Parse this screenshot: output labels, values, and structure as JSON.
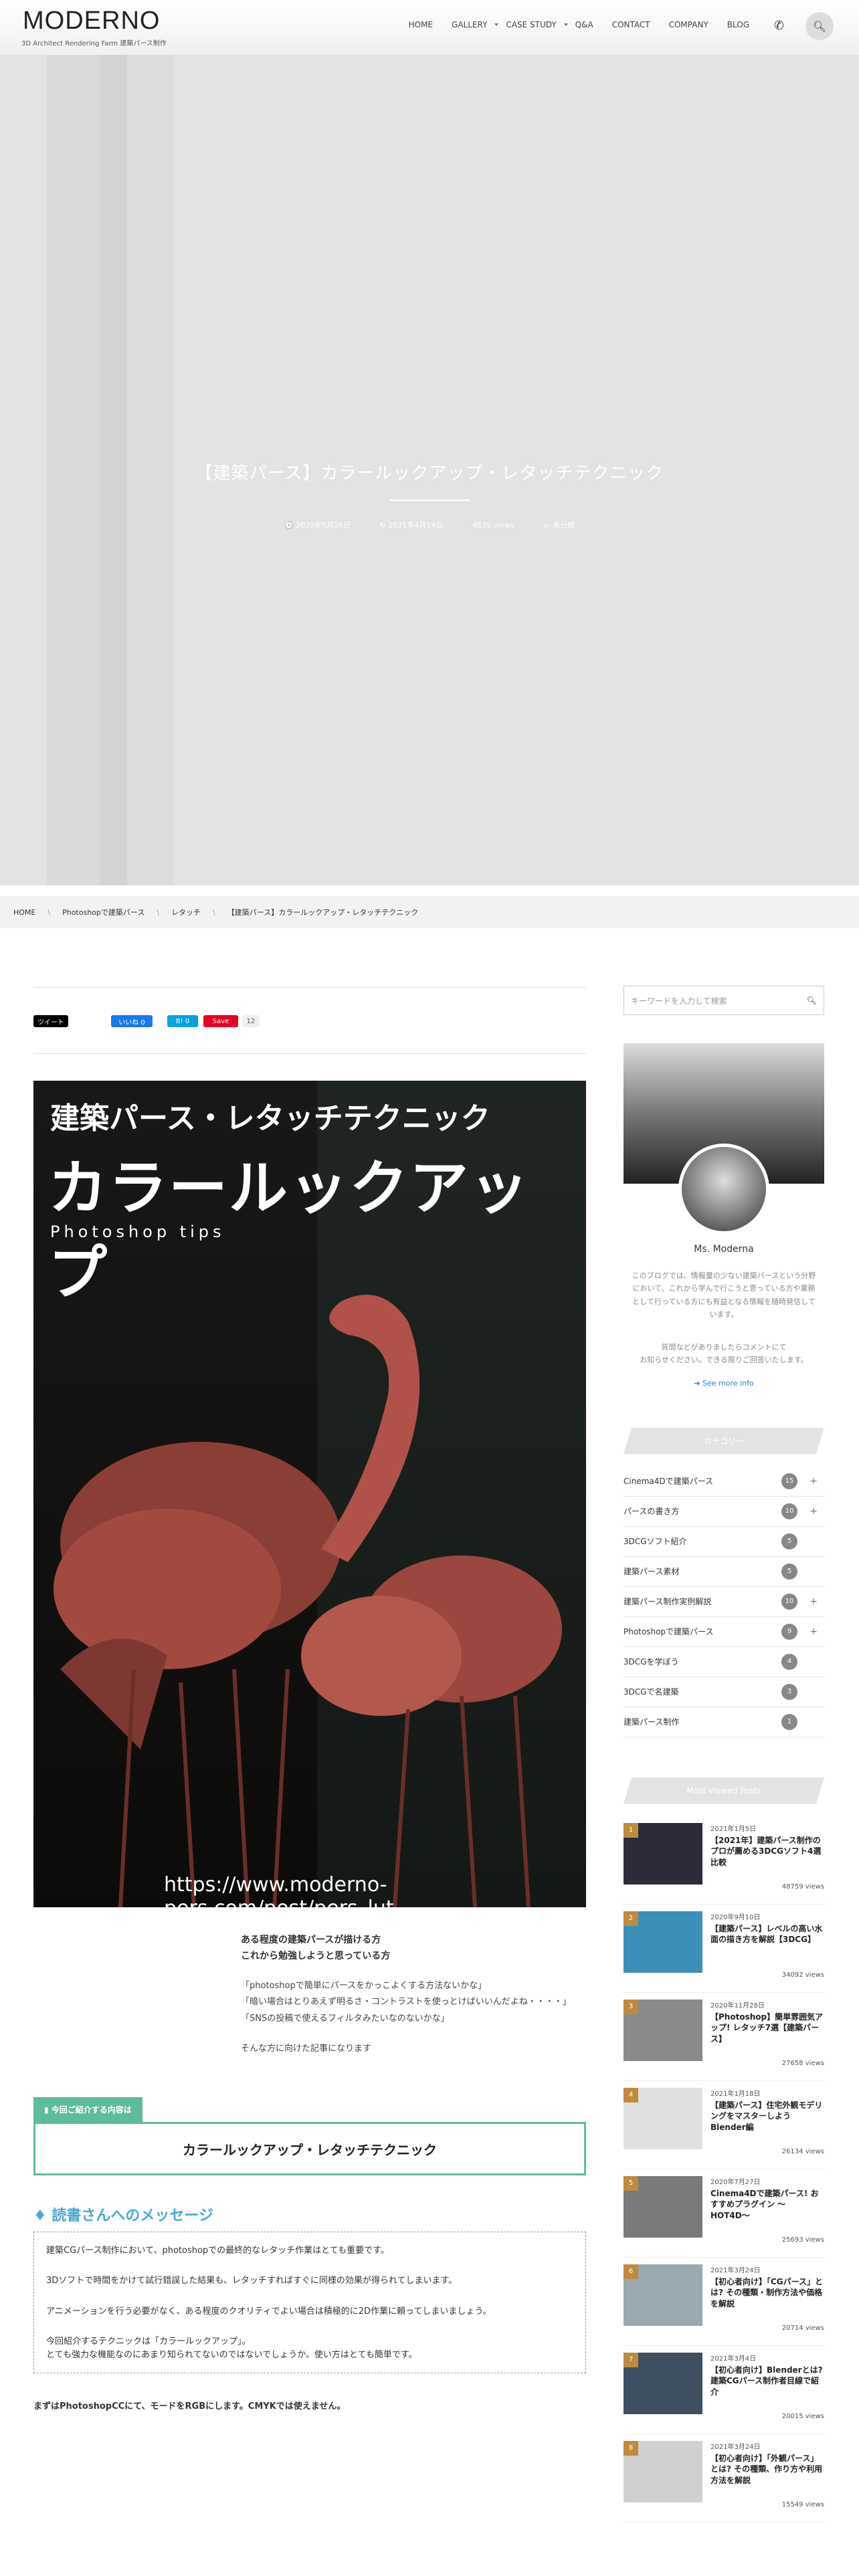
{
  "header": {
    "logo": "MODERNO",
    "tagline": "3D Architect Rendering Farm 建築パース制作",
    "nav": [
      "HOME",
      "GALLERY",
      "CASE STUDY",
      "Q&A",
      "CONTACT",
      "COMPANY",
      "BLOG"
    ]
  },
  "hero": {
    "title": "【建築パース】カラールックアップ・レタッチテクニック",
    "published": "2020年5月26日",
    "updated": "2021年4月14日",
    "views": "4635 views",
    "category": "未分類"
  },
  "breadcrumb": [
    "HOME",
    "Photoshopで建築パース",
    "レタッチ",
    "【建築パース】カラールックアップ・レタッチテクニック"
  ],
  "share": {
    "twitter": "ツイート",
    "like": "いいね 0",
    "hatena": "B! 0",
    "pin": "Save",
    "pin_count": "12"
  },
  "image": {
    "title1": "建築パース・レタッチテクニック",
    "title2": "カラールックアップ",
    "title3": "Photoshop tips",
    "url": "https://www.moderno-pers.com/post/pers_lut"
  },
  "lead": [
    "ある程度の建築パースが描ける方",
    "これから勉強しようと思っている方"
  ],
  "quotes": [
    "「photoshopで簡単にパースをかっこよくする方法ないかな」",
    "「暗い場合はとりあえず明るさ・コントラストを使っとけばいいんだよね・・・・」",
    "「SNSの投稿で使えるフィルタみたいなのないかな」",
    "そんな方に向けた記事になります"
  ],
  "tip": {
    "label": "今回ご紹介する内容は",
    "title": "カラールックアップ・レタッチテクニック"
  },
  "message": {
    "title": "読書さんへのメッセージ",
    "p1": "建築CGパース制作において、photoshopでの最終的なレタッチ作業はとても重要です。",
    "p2": "3Dソフトで時間をかけて試行錯誤した結果も、レタッチすればすぐに同様の効果が得られてしまいます。",
    "p3": "アニメーションを行う必要がなく、ある程度のクオリティでよい場合は積極的に2D作業に頼ってしまいましょう。",
    "p4a": "今回紹介するテクニックは「カラールックアップ」。",
    "p4b": "とても強力な機能なのにあまり知られてないのではないでしょうか。使い方はとても簡単です。"
  },
  "after": "まずはPhotoshopCCにて、モードをRGBにします。CMYKでは使えません。",
  "sidebar": {
    "search_placeholder": "キーワードを入力して検索",
    "profile": {
      "name": "Ms. Moderna",
      "desc": "このブログでは、情報量の少ない建築パースという分野において、これから学んで行こうと思っている方や業務として行っている方にも有益となる情報を随時発信しています。",
      "desc2a": "質問などがありましたらコメントにて",
      "desc2b": "お知らせください。できる限りご回答いたします。",
      "more": "See more info"
    },
    "cat_head": "カテゴリー",
    "categories": [
      {
        "name": "Cinema4Dで建築パース",
        "count": "15"
      },
      {
        "name": "パースの書き方",
        "count": "10"
      },
      {
        "name": "3DCGソフト紹介",
        "count": "5"
      },
      {
        "name": "建築パース素材",
        "count": "5"
      },
      {
        "name": "建築パース制作実例解説",
        "count": "10"
      },
      {
        "name": "Photoshopで建築パース",
        "count": "9"
      },
      {
        "name": "3DCGを学ぼう",
        "count": "4"
      },
      {
        "name": "3DCGで名建築",
        "count": "3"
      },
      {
        "name": "建築パース制作",
        "count": "1"
      }
    ],
    "pop_head": "Most Viewed Posts",
    "popular": [
      {
        "rank": "1",
        "date": "2021年1月5日",
        "title": "【2021年】建築パース制作のプロが薦める3DCGソフト4選比較",
        "views": "48759 views",
        "color": "#2b2b3a"
      },
      {
        "rank": "2",
        "date": "2020年9月10日",
        "title": "【建築パース】レベルの高い水面の描き方を解説【3DCG】",
        "views": "34092 views",
        "color": "#3c8fb8"
      },
      {
        "rank": "3",
        "date": "2020年11月28日",
        "title": "【Photoshop】簡単雰囲気アップ! レタッチ7選【建築パース】",
        "views": "27658 views",
        "color": "#8a8a8a"
      },
      {
        "rank": "4",
        "date": "2021年1月18日",
        "title": "【建築パース】住宅外観モデリングをマスターしよう Blender編",
        "views": "26134 views",
        "color": "#e0e0e0"
      },
      {
        "rank": "5",
        "date": "2020年7月27日",
        "title": "Cinema4Dで建築パース! おすすめプラグイン 〜HOT4D〜",
        "views": "25693 views",
        "color": "#7a7a7a"
      },
      {
        "rank": "6",
        "date": "2021年3月24日",
        "title": "【初心者向け】「CGパース」とは? その種類・制作方法や価格を解説",
        "views": "20714 views",
        "color": "#9aa8b0"
      },
      {
        "rank": "7",
        "date": "2021年3月4日",
        "title": "【初心者向け】Blenderとは? 建築CGパース制作者目線で紹介",
        "views": "20015 views",
        "color": "#3d4f60"
      },
      {
        "rank": "8",
        "date": "2021年3月24日",
        "title": "【初心者向け】「外観パース」とは? その種類、作り方や利用方法を解説",
        "views": "15549 views",
        "color": "#d0d0d0"
      }
    ]
  }
}
